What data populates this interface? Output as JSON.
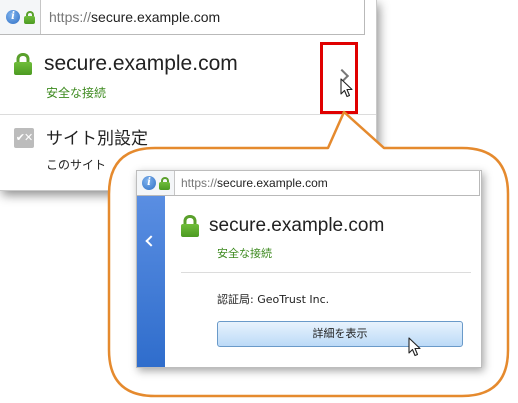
{
  "main_popup": {
    "url_bar": {
      "protocol": "https://",
      "host": "secure.example.com"
    },
    "identity": {
      "host": "secure.example.com",
      "status": "安全な接続"
    },
    "permissions": {
      "title": "サイト別設定",
      "subtitle": "このサイト"
    },
    "icons": {
      "info": "info-icon",
      "lock": "lock-icon",
      "more": "chevron-right-icon",
      "permissions": "permissions-icon"
    }
  },
  "detail_popup": {
    "url_bar": {
      "protocol": "https://",
      "host": "secure.example.com"
    },
    "identity": {
      "host": "secure.example.com",
      "status": "安全な接続"
    },
    "issuer_label": "認証局:",
    "issuer_value": "GeoTrust Inc.",
    "details_button": "詳細を表示",
    "icons": {
      "info": "info-icon",
      "lock": "lock-icon",
      "back": "chevron-left-icon"
    }
  },
  "colors": {
    "secure_green": "#3d8a1f",
    "lock_green": "#5aa02c",
    "highlight_red": "#e00000",
    "callout_orange": "#e58a2e",
    "back_strip_blue": "#3a78d4"
  }
}
